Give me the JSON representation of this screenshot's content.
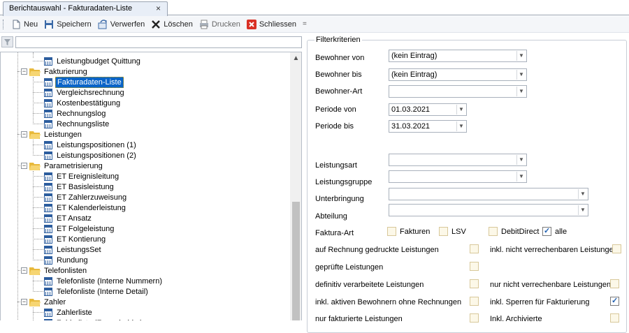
{
  "tab": {
    "title": "Berichtauswahl - Fakturadaten-Liste",
    "close": "×"
  },
  "toolbar": {
    "new": "Neu",
    "save": "Speichern",
    "discard": "Verwerfen",
    "delete": "Löschen",
    "print": "Drucken",
    "close": "Schliessen",
    "more": "="
  },
  "filter": {
    "value": ""
  },
  "tree": [
    {
      "label": "Leistungbudget Quittung",
      "type": "doc"
    },
    {
      "label": "Fakturierung",
      "type": "folder"
    },
    {
      "label": "Fakturadaten-Liste",
      "type": "doc",
      "selected": true
    },
    {
      "label": "Vergleichsrechnung",
      "type": "doc"
    },
    {
      "label": "Kostenbestätigung",
      "type": "doc"
    },
    {
      "label": "Rechnungslog",
      "type": "doc"
    },
    {
      "label": "Rechnungsliste",
      "type": "doc"
    },
    {
      "label": "Leistungen",
      "type": "folder"
    },
    {
      "label": "Leistungspositionen (1)",
      "type": "doc"
    },
    {
      "label": "Leistungspositionen (2)",
      "type": "doc"
    },
    {
      "label": "Parametrisierung",
      "type": "folder"
    },
    {
      "label": "ET Ereignisleitung",
      "type": "doc"
    },
    {
      "label": "ET Basisleistung",
      "type": "doc"
    },
    {
      "label": "ET Zahlerzuweisung",
      "type": "doc"
    },
    {
      "label": "ET Kalenderleistung",
      "type": "doc"
    },
    {
      "label": "ET Ansatz",
      "type": "doc"
    },
    {
      "label": "ET Folgeleistung",
      "type": "doc"
    },
    {
      "label": "ET Kontierung",
      "type": "doc"
    },
    {
      "label": "LeistungsSet",
      "type": "doc"
    },
    {
      "label": "Rundung",
      "type": "doc"
    },
    {
      "label": "Telefonlisten",
      "type": "folder"
    },
    {
      "label": "Telefonliste (Interne Nummern)",
      "type": "doc"
    },
    {
      "label": "Telefonliste (Interne Detail)",
      "type": "doc"
    },
    {
      "label": "Zahler",
      "type": "folder"
    },
    {
      "label": "Zahlerliste",
      "type": "doc"
    },
    {
      "label": "Zahlerliste (Formularbl...)",
      "type": "doc"
    }
  ],
  "form": {
    "title": "Filterkriterien",
    "bewohner_von": {
      "label": "Bewohner von",
      "value": "(kein Eintrag)"
    },
    "bewohner_bis": {
      "label": "Bewohner bis",
      "value": "(kein Eintrag)"
    },
    "bewohner_art": {
      "label": "Bewohner-Art",
      "value": ""
    },
    "periode_von": {
      "label": "Periode von",
      "value": "01.03.2021"
    },
    "periode_bis": {
      "label": "Periode bis",
      "value": "31.03.2021"
    },
    "leistungsart": {
      "label": "Leistungsart",
      "value": ""
    },
    "leistungsgruppe": {
      "label": "Leistungsgruppe",
      "value": ""
    },
    "unterbringung": {
      "label": "Unterbringung",
      "value": ""
    },
    "abteilung": {
      "label": "Abteilung",
      "value": ""
    },
    "faktura_art": {
      "label": "Faktura-Art",
      "options": [
        {
          "label": "Fakturen",
          "checked": false
        },
        {
          "label": "LSV",
          "checked": false
        },
        {
          "label": "DebitDirect",
          "checked": false
        },
        {
          "label": "alle",
          "checked": true
        }
      ]
    },
    "checks_left": [
      {
        "label": "auf Rechnung gedruckte Leistungen",
        "checked": false
      },
      {
        "label": "geprüfte Leistungen",
        "checked": false
      },
      {
        "label": "definitiv verarbeitete Leistungen",
        "checked": false
      },
      {
        "label": "inkl. aktiven Bewohnern ohne Rechnungen",
        "checked": false
      },
      {
        "label": "nur fakturierte Leistungen",
        "checked": false
      }
    ],
    "checks_right": [
      {
        "label": "inkl. nicht verrechenbaren Leistungen",
        "checked": false
      },
      {
        "label": "nur nicht verrechenbare Leistungen",
        "checked": false
      },
      {
        "label": "inkl. Sperren für Fakturierung",
        "checked": true
      },
      {
        "label": "Inkl. Archivierte",
        "checked": false
      }
    ]
  },
  "colors": {
    "selection": "#0a64c8",
    "accent": "#1f5fb0"
  }
}
